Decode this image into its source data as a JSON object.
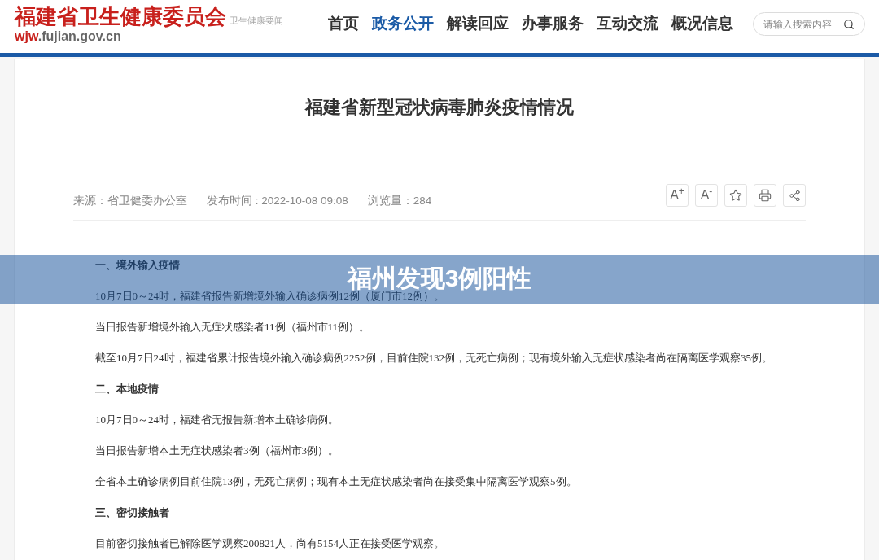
{
  "header": {
    "logo_title": "福建省卫生健康委员会",
    "faded_text": "卫生健康要闻",
    "url": {
      "highlight": "wjw",
      "rest": ".fujian.gov.cn"
    }
  },
  "nav": [
    {
      "label": "首页",
      "selected": false
    },
    {
      "label": "政务公开",
      "selected": true
    },
    {
      "label": "解读回应",
      "selected": false
    },
    {
      "label": "办事服务",
      "selected": false
    },
    {
      "label": "互动交流",
      "selected": false
    },
    {
      "label": "概况信息",
      "selected": false
    }
  ],
  "search": {
    "placeholder": "请输入搜索内容"
  },
  "article": {
    "title": "福建省新型冠状病毒肺炎疫情情况",
    "meta": [
      "来源：省卫健委办公室",
      "发布时间 : 2022-10-08 09:08",
      "浏览量：284"
    ],
    "tools": [
      {
        "kind": "font_up",
        "label": "A$^{+}$"
      },
      {
        "kind": "font_down",
        "label": "A$^{-}$"
      },
      {
        "kind": "star"
      },
      {
        "kind": "print"
      },
      {
        "kind": "share"
      }
    ],
    "paragraphs": [
      {
        "kind": "heading",
        "text": "一、境外输入疫情"
      },
      {
        "kind": "body",
        "text": "10月7日0～24时，福建省报告新增境外输入确诊病例12例（厦门市12例）。"
      },
      {
        "kind": "body",
        "text": "当日报告新增境外输入无症状感染者11例（福州市11例）。"
      },
      {
        "kind": "body",
        "text": "截至10月7日24时，福建省累计报告境外输入确诊病例2252例，目前住院132例，无死亡病例；现有境外输入无症状感染者尚在隔离医学观察35例。"
      },
      {
        "kind": "heading",
        "text": "二、本地疫情"
      },
      {
        "kind": "body",
        "text": "10月7日0～24时，福建省无报告新增本土确诊病例。"
      },
      {
        "kind": "body",
        "text": "当日报告新增本土无症状感染者3例（福州市3例）。"
      },
      {
        "kind": "body",
        "text": "全省本土确诊病例目前住院13例，无死亡病例；现有本土无症状感染者尚在接受集中隔离医学观察5例。"
      },
      {
        "kind": "heading",
        "text": "三、密切接触者"
      },
      {
        "kind": "body",
        "text": "目前密切接触者已解除医学观察200821人，尚有5154人正在接受医学观察。"
      }
    ]
  },
  "banner": {
    "title": "福州发现3例阳性"
  }
}
